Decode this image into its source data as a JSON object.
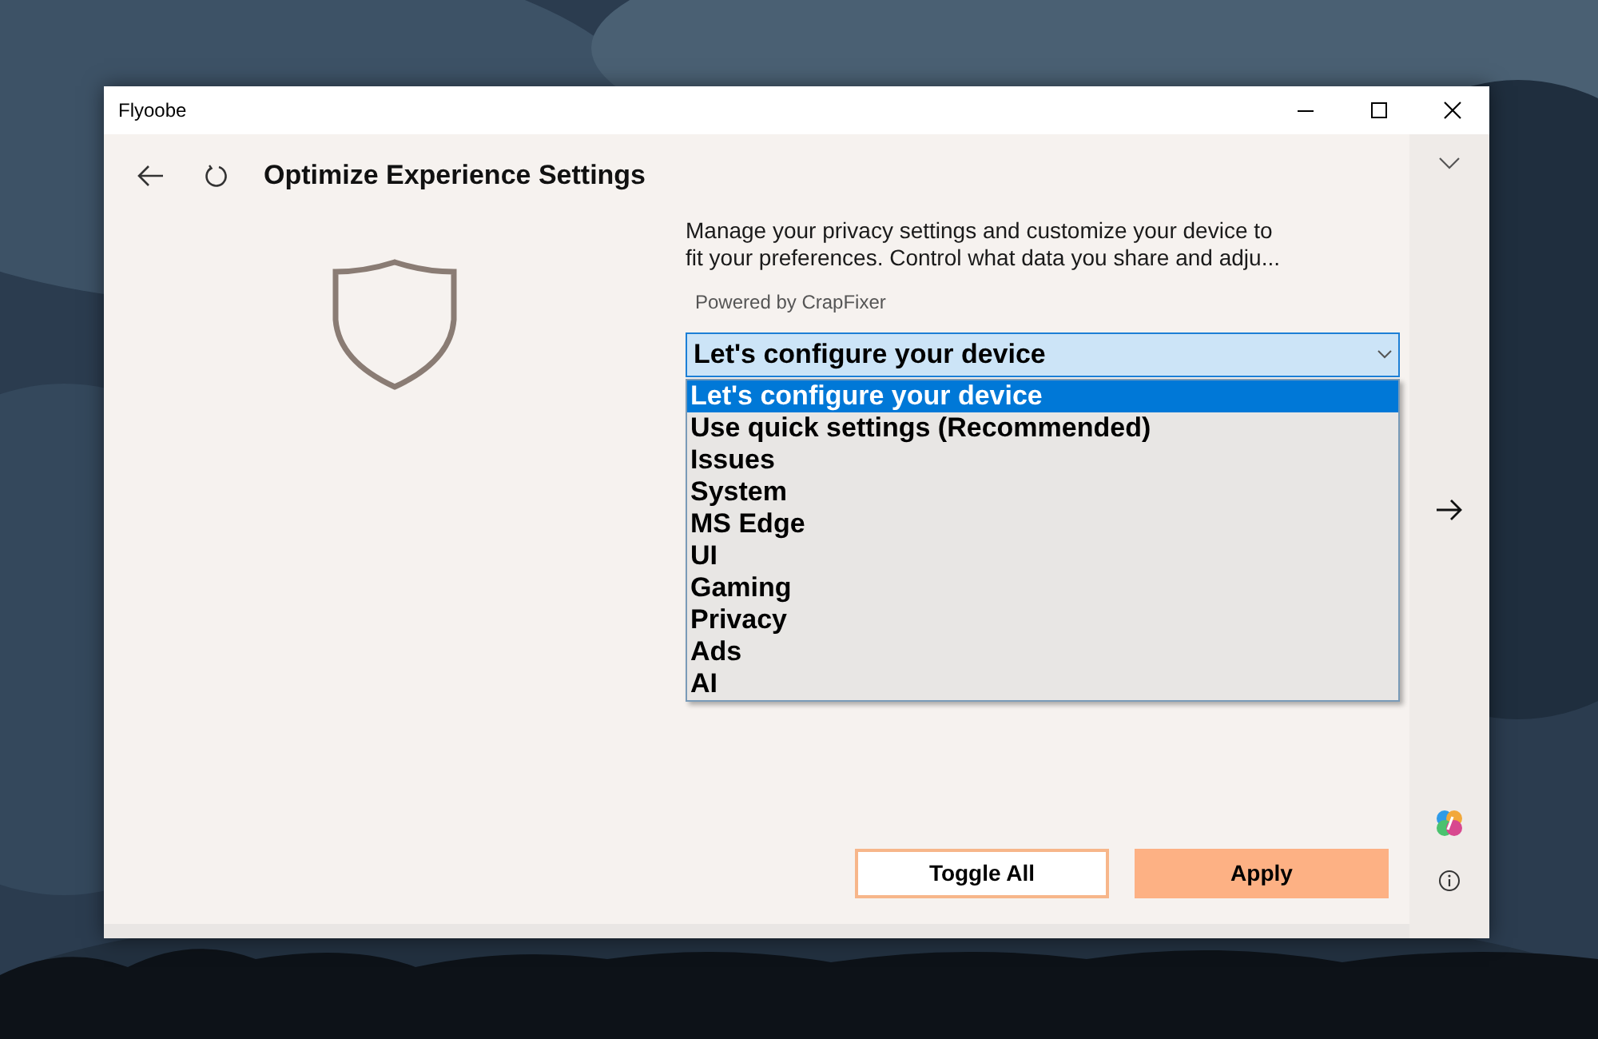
{
  "window": {
    "title": "Flyoobe"
  },
  "page": {
    "title": "Optimize Experience Settings",
    "description": "Manage your privacy settings and customize your device to fit your preferences. Control what data you share and adju...",
    "powered_by": "Powered by CrapFixer"
  },
  "dropdown": {
    "value": "Let's configure your device",
    "expanded": true,
    "options": [
      {
        "label": "Let's configure your device",
        "selected": true
      },
      {
        "label": "Use quick settings (Recommended)",
        "selected": false
      },
      {
        "label": "Issues",
        "selected": false
      },
      {
        "label": "System",
        "selected": false
      },
      {
        "label": "MS Edge",
        "selected": false
      },
      {
        "label": "UI",
        "selected": false
      },
      {
        "label": "Gaming",
        "selected": false
      },
      {
        "label": "Privacy",
        "selected": false
      },
      {
        "label": "Ads",
        "selected": false
      },
      {
        "label": "AI",
        "selected": false
      }
    ]
  },
  "buttons": [
    {
      "label": "Toggle All",
      "kind": "outline"
    },
    {
      "label": "Apply",
      "kind": "primary"
    }
  ]
}
